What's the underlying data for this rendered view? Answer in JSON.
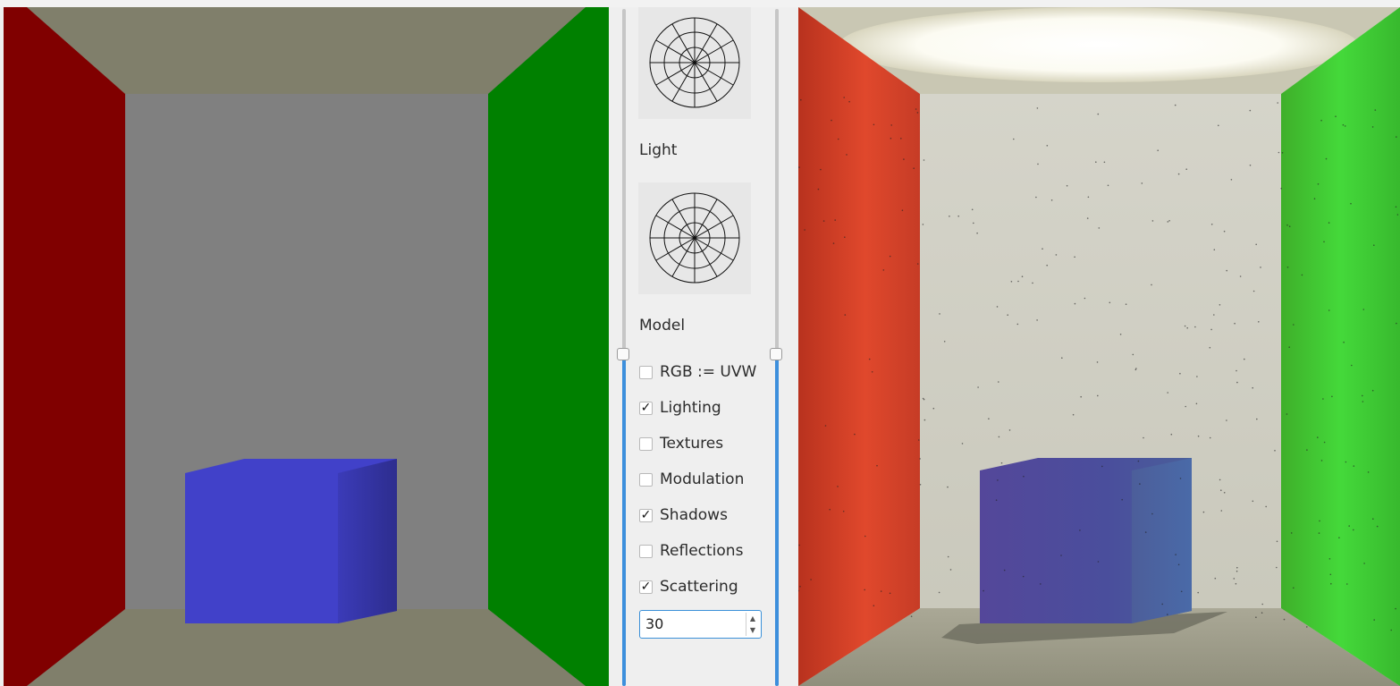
{
  "panel": {
    "light_label": "Light",
    "model_label": "Model",
    "options": [
      {
        "label": "RGB := UVW",
        "checked": false
      },
      {
        "label": "Lighting",
        "checked": true
      },
      {
        "label": "Textures",
        "checked": false
      },
      {
        "label": "Modulation",
        "checked": false
      },
      {
        "label": "Shadows",
        "checked": true
      },
      {
        "label": "Reflections",
        "checked": false
      },
      {
        "label": "Scattering",
        "checked": true
      }
    ],
    "check_mark": "✓",
    "samples_value": "30",
    "left_slider_level": 0.49,
    "right_slider_level": 0.49
  },
  "scene_colors": {
    "left_wall": "#800000",
    "right_wall": "#008000",
    "back_wall": "#808080",
    "floor_ceiling": "#807f6b",
    "cube_front": "#4141c9",
    "cube_side": "#2e2e94"
  },
  "icons": {
    "light_orientation": "wireframe-sphere-icon",
    "model_orientation": "wireframe-sphere-icon"
  }
}
